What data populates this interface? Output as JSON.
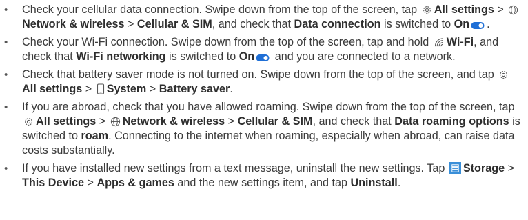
{
  "items": [
    {
      "t1": "Check your cellular data connection. Swipe down from the top of the screen, tap ",
      "icon1": "gear-icon",
      "b1": "All settings",
      "t2": " > ",
      "icon2": "globe-icon",
      "b2": "Network & wireless",
      "t3": " > ",
      "b3": "Cellular & SIM",
      "t4": ", and check that ",
      "b4": "Data connection",
      "t5": " is switched to ",
      "b5": "On",
      "icon3": "toggle-on-icon",
      "t6": "."
    },
    {
      "t1": "Check your Wi-Fi connection. Swipe down from the top of the screen, tap and hold ",
      "icon1": "wifi-icon",
      "b1": "Wi-Fi",
      "t2": ", and check that ",
      "b2": "Wi-Fi networking",
      "t3": " is switched to ",
      "b3": "On",
      "icon2": "toggle-on-icon",
      "t4": " and you are connected to a network."
    },
    {
      "t1": "Check that battery saver mode is not turned on. Swipe down from the top of the screen, and tap ",
      "icon1": "gear-icon",
      "b1": "All settings",
      "t2": " > ",
      "icon2": "phone-icon",
      "b2": "System",
      "t3": " > ",
      "b3": "Battery saver",
      "t4": "."
    },
    {
      "t1": "If you are abroad, check that you have allowed roaming. Swipe down from the top of the screen, tap ",
      "icon1": "gear-icon",
      "b1": "All settings",
      "t2": " > ",
      "icon2": "globe-icon",
      "b2": "Network & wireless",
      "t3": " > ",
      "b3": "Cellular & SIM",
      "t4": ", and check that ",
      "b4": "Data roaming options",
      "t5": " is switched to ",
      "b5": "roam",
      "t6": ". Connecting to the internet when roaming, especially when abroad, can raise data costs substantially."
    },
    {
      "t1": "If you have installed new settings from a text message, uninstall the new settings. Tap ",
      "icon1": "storage-app-icon",
      "b1": "Storage",
      "t2": " > ",
      "b2": "This Device",
      "t3": " > ",
      "b3": "Apps & games",
      "t4": " and the new settings item, and tap ",
      "b4": "Uninstall",
      "t5": "."
    }
  ],
  "colors": {
    "text": "#3b3b3b",
    "bold": "#2e2e2e",
    "toggle": "#1f6fd6",
    "storage_icon": "#3a8fd8"
  }
}
